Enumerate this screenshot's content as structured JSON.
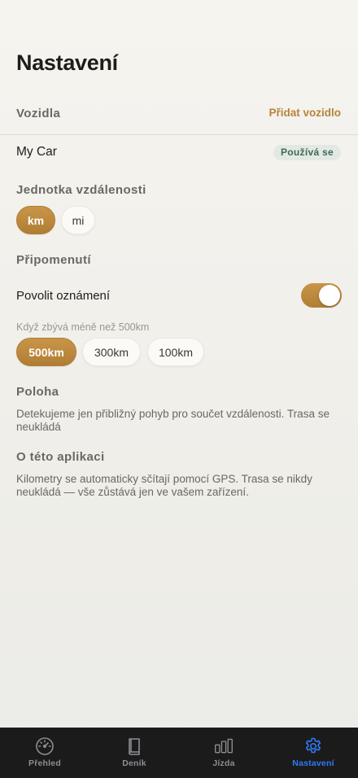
{
  "header": {
    "title": "Nastavení"
  },
  "vehicles": {
    "label": "Vozidla",
    "add_label": "Přidat vozidlo",
    "car_name": "My Car",
    "car_badge": "Používá se"
  },
  "distance_unit": {
    "label": "Jednotka vzdálenosti",
    "options": [
      "km",
      "mi"
    ],
    "selected": "km"
  },
  "reminders": {
    "label": "Připomenutí",
    "notify_label": "Povolit oznámení",
    "notify_enabled": true,
    "threshold_hint": "Když zbývá méně než 500km",
    "threshold_options": [
      "500km",
      "300km",
      "100km"
    ],
    "selected": "500km"
  },
  "location": {
    "label": "Poloha",
    "text": "Detekujeme jen přibližný pohyb pro součet vzdálenosti. Trasa se neukládá"
  },
  "about": {
    "label": "O této aplikaci",
    "text": "Kilometry se automaticky sčítají pomocí GPS. Trasa se nikdy neukládá — vše zůstává jen ve vašem zařízení."
  },
  "tabbar": {
    "tabs": [
      {
        "label": "Přehled",
        "icon": "speedometer-icon"
      },
      {
        "label": "Deník",
        "icon": "book-icon"
      },
      {
        "label": "Jízda",
        "icon": "bar-chart-icon"
      },
      {
        "label": "Nastavení",
        "icon": "gear-icon"
      }
    ],
    "active": "Nastavení"
  },
  "colors": {
    "accent": "#b6843a",
    "badge_bg": "#e2e9e4",
    "badge_text": "#3f6a52",
    "tab_active": "#2f7bf5",
    "tabbar_bg": "#1b1b1c"
  }
}
